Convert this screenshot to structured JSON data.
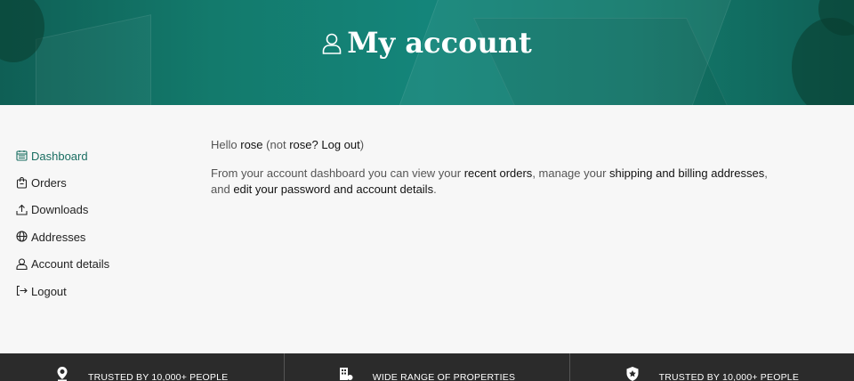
{
  "header": {
    "title": "My account",
    "icon": "user-icon",
    "color": "#137a6c"
  },
  "sidebar": {
    "items": [
      {
        "label": "Dashboard",
        "icon": "calendar-icon",
        "active": true
      },
      {
        "label": "Orders",
        "icon": "bag-icon"
      },
      {
        "label": "Downloads",
        "icon": "upload-icon"
      },
      {
        "label": "Addresses",
        "icon": "globe-icon"
      },
      {
        "label": "Account details",
        "icon": "user-icon"
      },
      {
        "label": "Logout",
        "icon": "logout-icon"
      }
    ],
    "active_color": "#1a6e62"
  },
  "main": {
    "greeting": {
      "hello": "Hello",
      "user": "rose",
      "not_prefix": "(not",
      "user2": "rose",
      "q": "?",
      "logout": "Log out",
      "close": ")"
    },
    "intro": {
      "text1": "From your account dashboard you can view your",
      "link_orders": "recent orders",
      "text2": ", manage your",
      "link_addresses": "shipping and billing addresses",
      "text3": ",",
      "text4": "and",
      "link_details": "edit your password and account details",
      "text5": "."
    }
  },
  "footer": {
    "features": [
      {
        "label": "TRUSTED BY 10,000+ PEOPLE",
        "icon": "pin-icon"
      },
      {
        "label": "WIDE RANGE OF PROPERTIES",
        "icon": "building-icon"
      },
      {
        "label": "TRUSTED BY 10,000+ PEOPLE",
        "icon": "shield-star-icon"
      }
    ],
    "background": "#2b2b2b"
  }
}
